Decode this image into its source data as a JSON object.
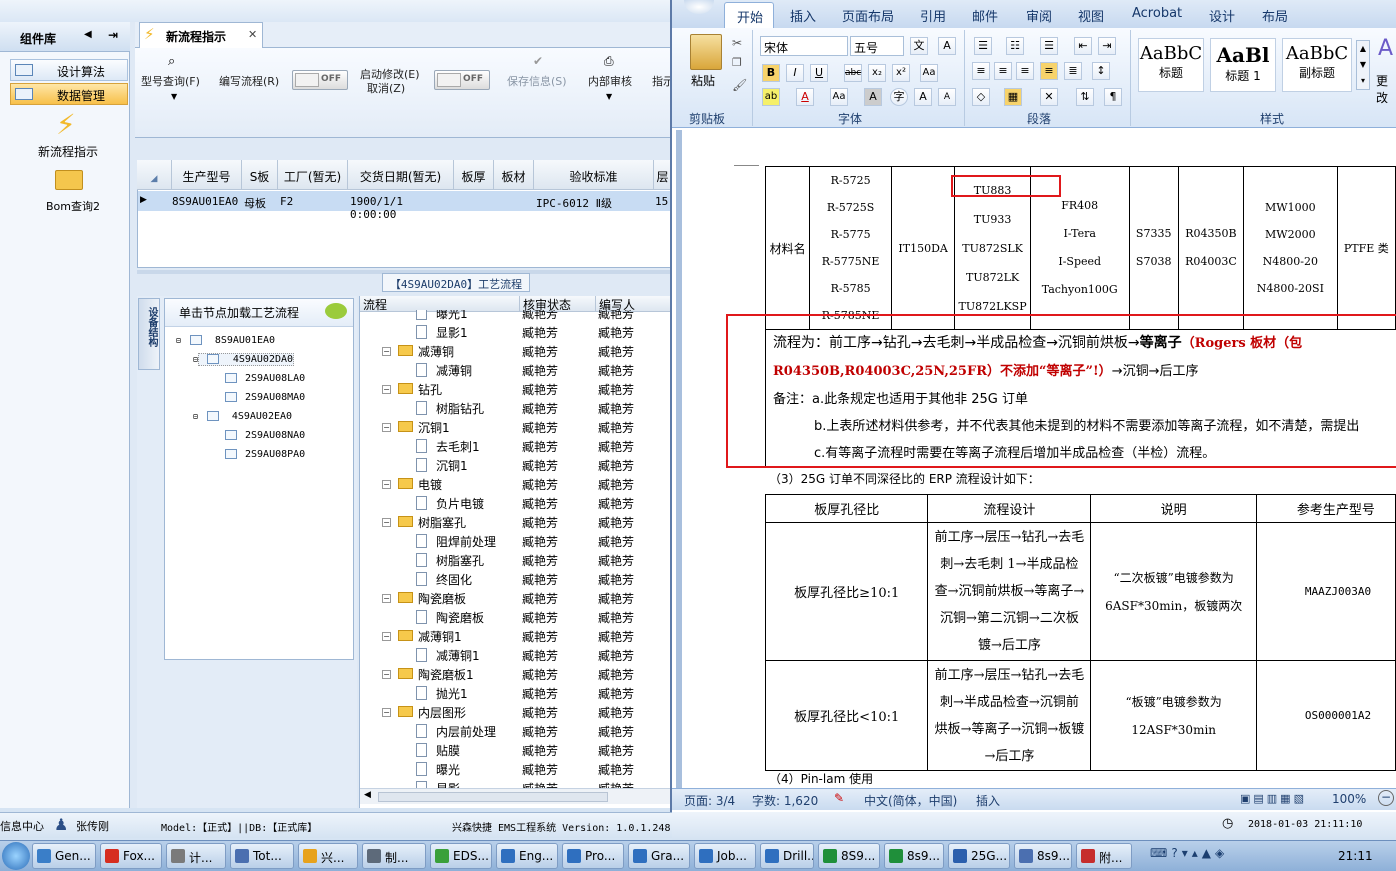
{
  "sidebar": {
    "title": "组件库",
    "items": [
      {
        "label": "设计算法"
      },
      {
        "label": "数据管理"
      }
    ],
    "icons": [
      {
        "label": "新流程指示"
      },
      {
        "label": "Bom查询2"
      }
    ]
  },
  "tab": {
    "title": "新流程指示"
  },
  "toolbar": {
    "model_query": "型号查询(F)",
    "write_flow": "编写流程(R)",
    "toggle1": "OFF",
    "start_modify": "启动修改(E)",
    "cancel": "取消(Z)",
    "toggle2": "OFF",
    "save_info": "保存信息(S)",
    "internal_review": "内部审核",
    "more": "指示"
  },
  "grid": {
    "headers": [
      "生产型号",
      "S板",
      "工厂(暂无)",
      "交货日期(暂无)",
      "板厚",
      "板材",
      "验收标准",
      "层"
    ],
    "row": [
      "8S9AU01EA0",
      "母板",
      "F2",
      "1900/1/1 0:00:00",
      "",
      "",
      "IPC-6012 Ⅱ级",
      "15"
    ]
  },
  "process_title": "【4S9AU02DA0】工艺流程",
  "left_panel": {
    "vtab": "设备结构",
    "tree_head": "单击节点加载工艺流程",
    "nodes": [
      "8S9AU01EA0",
      "4S9AU02DA0",
      "2S9AU08LA0",
      "2S9AU08MA0",
      "4S9AU02EA0",
      "2S9AU08NA0",
      "2S9AU08PA0"
    ]
  },
  "flow": {
    "headers": [
      "流程",
      "核审状态",
      "编写人"
    ],
    "rows": [
      {
        "name": "曝光1",
        "status": "臧艳芳",
        "writer": "臧艳芳",
        "kind": "doc"
      },
      {
        "name": "显影1",
        "status": "臧艳芳",
        "writer": "臧艳芳",
        "kind": "doc"
      },
      {
        "name": "减薄铜",
        "status": "臧艳芳",
        "writer": "臧艳芳",
        "kind": "folder"
      },
      {
        "name": "减薄铜",
        "status": "臧艳芳",
        "writer": "臧艳芳",
        "kind": "doc"
      },
      {
        "name": "钻孔",
        "status": "臧艳芳",
        "writer": "臧艳芳",
        "kind": "folder"
      },
      {
        "name": "树脂钻孔",
        "status": "臧艳芳",
        "writer": "臧艳芳",
        "kind": "doc"
      },
      {
        "name": "沉铜1",
        "status": "臧艳芳",
        "writer": "臧艳芳",
        "kind": "folder"
      },
      {
        "name": "去毛刺1",
        "status": "臧艳芳",
        "writer": "臧艳芳",
        "kind": "doc"
      },
      {
        "name": "沉铜1",
        "status": "臧艳芳",
        "writer": "臧艳芳",
        "kind": "doc"
      },
      {
        "name": "电镀",
        "status": "臧艳芳",
        "writer": "臧艳芳",
        "kind": "folder"
      },
      {
        "name": "负片电镀",
        "status": "臧艳芳",
        "writer": "臧艳芳",
        "kind": "doc"
      },
      {
        "name": "树脂塞孔",
        "status": "臧艳芳",
        "writer": "臧艳芳",
        "kind": "folder"
      },
      {
        "name": "阻焊前处理",
        "status": "臧艳芳",
        "writer": "臧艳芳",
        "kind": "doc"
      },
      {
        "name": "树脂塞孔",
        "status": "臧艳芳",
        "writer": "臧艳芳",
        "kind": "doc"
      },
      {
        "name": "终固化",
        "status": "臧艳芳",
        "writer": "臧艳芳",
        "kind": "doc"
      },
      {
        "name": "陶瓷磨板",
        "status": "臧艳芳",
        "writer": "臧艳芳",
        "kind": "folder"
      },
      {
        "name": "陶瓷磨板",
        "status": "臧艳芳",
        "writer": "臧艳芳",
        "kind": "doc"
      },
      {
        "name": "减薄铜1",
        "status": "臧艳芳",
        "writer": "臧艳芳",
        "kind": "folder"
      },
      {
        "name": "减薄铜1",
        "status": "臧艳芳",
        "writer": "臧艳芳",
        "kind": "doc"
      },
      {
        "name": "陶瓷磨板1",
        "status": "臧艳芳",
        "writer": "臧艳芳",
        "kind": "folder"
      },
      {
        "name": "抛光1",
        "status": "臧艳芳",
        "writer": "臧艳芳",
        "kind": "doc"
      },
      {
        "name": "内层图形",
        "status": "臧艳芳",
        "writer": "臧艳芳",
        "kind": "folder"
      },
      {
        "name": "内层前处理",
        "status": "臧艳芳",
        "writer": "臧艳芳",
        "kind": "doc"
      },
      {
        "name": "贴膜",
        "status": "臧艳芳",
        "writer": "臧艳芳",
        "kind": "doc"
      },
      {
        "name": "曝光",
        "status": "臧艳芳",
        "writer": "臧艳芳",
        "kind": "doc"
      },
      {
        "name": "显影",
        "status": "臧艳芳",
        "writer": "臧艳芳",
        "kind": "doc"
      }
    ]
  },
  "app_status": {
    "info": "信息中心",
    "user": "张传刚",
    "model": "Model:【正式】||DB:【正式库】",
    "system": "兴森快捷 EMS工程系统 Version: 1.0.1.248",
    "datetime": "2018-01-03 21:11:10"
  },
  "word": {
    "tabs": [
      "开始",
      "插入",
      "页面布局",
      "引用",
      "邮件",
      "审阅",
      "视图",
      "Acrobat",
      "设计",
      "布局"
    ],
    "font_name": "宋体",
    "font_size": "五号",
    "groups": [
      "剪贴板",
      "字体",
      "段落",
      "样式"
    ],
    "paste": "粘贴",
    "styles": [
      {
        "sample": "AaBbC",
        "name": "标题"
      },
      {
        "sample": "AaBl",
        "name": "标题 1"
      },
      {
        "sample": "AaBbC",
        "name": "副标题"
      }
    ],
    "change_styles": "更改",
    "material_label": "材料名",
    "materials": [
      [
        "R-5725",
        "R-5725S",
        "R-5775",
        "R-5775NE",
        "R-5785",
        "R-5785NE"
      ],
      [
        "IT150DA"
      ],
      [
        "TU883",
        "TU933",
        "TU872SLK",
        "TU872LK",
        "TU872LKSP"
      ],
      [
        "FR408",
        "I-Tera",
        "I-Speed",
        "Tachyon100G"
      ],
      [
        "S7335",
        "S7038"
      ],
      [
        "R04350B",
        "R04003C"
      ],
      [
        "MW1000",
        "MW2000",
        "N4800-20",
        "N4800-20SI"
      ],
      [
        "PTFE 类"
      ]
    ],
    "flow_line1_a": "流程为：前工序→钻孔→去毛刺→半成品检查→沉铜前烘板→",
    "flow_line1_b": "等离子",
    "flow_line1_red": "（Rogers 板材（包",
    "flow_line2_red": "R04350B,R04003C,25N,25FR）不添加“等离子”!）",
    "flow_line2_b": "→沉铜→后工序",
    "note1": "备注：a.此条规定也适用于其他非 25G 订单",
    "note2": "b.上表所述材料供参考，并不代表其他未提到的材料不需要添加等离子流程，如不清楚，需提出",
    "note3": "c.有等离子流程时需要在等离子流程后增加半成品检查（半检）流程。",
    "section3": "（3）25G 订单不同深径比的 ERP 流程设计如下：",
    "table2_headers": [
      "板厚孔径比",
      "流程设计",
      "说明",
      "参考生产型号"
    ],
    "table2_rows": [
      {
        "ratio": "板厚孔径比≥10:1",
        "flow": "前工序→层压→钻孔→去毛刺→去毛刺 1→半成品检查→沉铜前烘板→等离子→沉铜→第二沉铜→二次板镀→后工序",
        "desc": "“二次板镀”电镀参数为 6ASF*30min，板镀两次",
        "ref": "MAAZJ003A0"
      },
      {
        "ratio": "板厚孔径比<10:1",
        "flow": "前工序→层压→钻孔→去毛刺→半成品检查→沉铜前烘板→等离子→沉铜→板镀→后工序",
        "desc": "“板镀”电镀参数为 12ASF*30min",
        "ref": "OS000001A2"
      }
    ],
    "section4": "（4）Pin-lam 使用",
    "status": {
      "page": "页面: 3/4",
      "words": "字数: 1,620",
      "lang": "中文(简体，中国)",
      "mode": "插入",
      "zoom": "100%"
    }
  },
  "taskbar": {
    "items": [
      "Gen...",
      "Fox...",
      "计...",
      "Tot...",
      "兴...",
      "制...",
      "EDS...",
      "Eng...",
      "Pro...",
      "Gra...",
      "Job...",
      "Drill...",
      "8S9...",
      "8s9...",
      "25G...",
      "8s9...",
      "附..."
    ],
    "clock": "21:11"
  }
}
